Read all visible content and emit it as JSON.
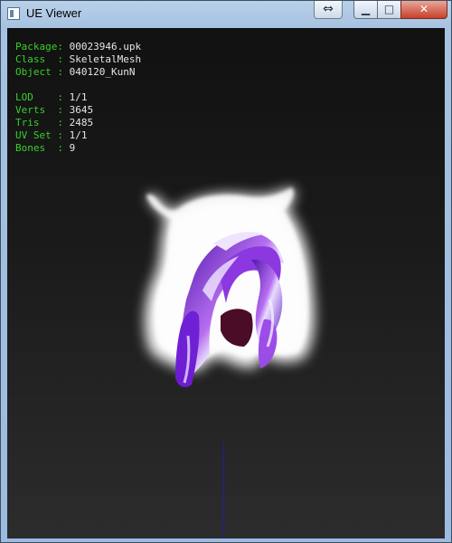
{
  "window": {
    "title": "UE Viewer",
    "swap_button": "⇔",
    "minimize_glyph": "▁",
    "maximize_glyph": "□",
    "close_glyph": "✕"
  },
  "info": {
    "package_label": "Package:",
    "package_value": "00023946.upk",
    "class_label": "Class  :",
    "class_value": "SkeletalMesh",
    "object_label": "Object :",
    "object_value": "040120_KunN",
    "lod_label": "LOD    :",
    "lod_value": "1/1",
    "verts_label": "Verts  :",
    "verts_value": "3645",
    "tris_label": "Tris   :",
    "tris_value": "2485",
    "uvset_label": "UV Set :",
    "uvset_value": "1/1",
    "bones_label": "Bones  :",
    "bones_value": "9"
  },
  "colors": {
    "label_green": "#37d02a",
    "value_white": "#e6e6e6",
    "hair_purple": "#7a1fd6",
    "axis_blue": "#1e1ea8"
  }
}
